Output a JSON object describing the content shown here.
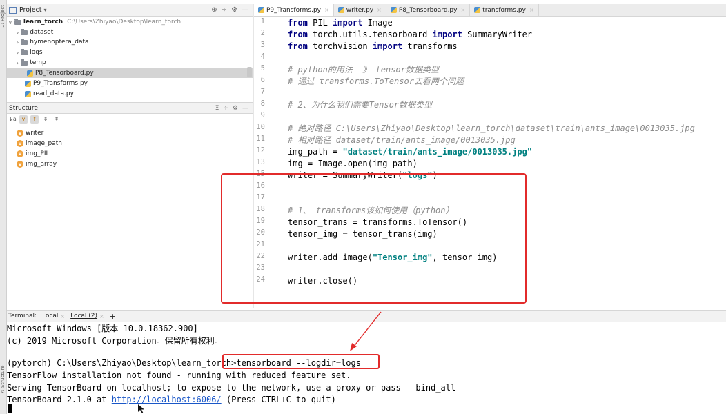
{
  "project_panel": {
    "title": "Project",
    "root": {
      "name": "learn_torch",
      "path": "C:\\Users\\Zhiyao\\Desktop\\learn_torch"
    },
    "items": [
      {
        "label": "dataset",
        "type": "folder"
      },
      {
        "label": "hymenoptera_data",
        "type": "folder"
      },
      {
        "label": "logs",
        "type": "folder"
      },
      {
        "label": "temp",
        "type": "folder"
      },
      {
        "label": "P8_Tensorboard.py",
        "type": "file"
      },
      {
        "label": "P9_Transforms.py",
        "type": "file"
      },
      {
        "label": "read_data.py",
        "type": "file"
      }
    ]
  },
  "left_stripe": {
    "project_tab": "1: Project",
    "structure_tab": "7: Structure"
  },
  "structure_panel": {
    "title": "Structure",
    "toolbar": {
      "sort": "↓a",
      "v_toggle": "v",
      "f_toggle": "f"
    },
    "items": [
      {
        "label": "writer",
        "icon_letter": "v"
      },
      {
        "label": "image_path",
        "icon_letter": "v"
      },
      {
        "label": "img_PIL",
        "icon_letter": "v"
      },
      {
        "label": "img_array",
        "icon_letter": "v"
      }
    ]
  },
  "editor_tabs": [
    {
      "label": "P9_Transforms.py",
      "active": true
    },
    {
      "label": "writer.py",
      "active": false
    },
    {
      "label": "P8_Tensorboard.py",
      "active": false
    },
    {
      "label": "transforms.py",
      "active": false
    }
  ],
  "editor": {
    "lines": [
      {
        "n": "1",
        "code": [
          {
            "t": "kw",
            "v": "from"
          },
          {
            "t": "p",
            "v": " PIL "
          },
          {
            "t": "kw",
            "v": "import"
          },
          {
            "t": "p",
            "v": " Image"
          }
        ]
      },
      {
        "n": "2",
        "code": [
          {
            "t": "kw",
            "v": "from"
          },
          {
            "t": "p",
            "v": " torch.utils.tensorboard "
          },
          {
            "t": "kw",
            "v": "import"
          },
          {
            "t": "p",
            "v": " SummaryWriter"
          }
        ]
      },
      {
        "n": "3",
        "code": [
          {
            "t": "kw",
            "v": "from"
          },
          {
            "t": "p",
            "v": " torchvision "
          },
          {
            "t": "kw",
            "v": "import"
          },
          {
            "t": "p",
            "v": " transforms"
          }
        ]
      },
      {
        "n": "4",
        "code": []
      },
      {
        "n": "5",
        "code": [
          {
            "t": "cm",
            "v": "# python的用法 -》 tensor数据类型"
          }
        ]
      },
      {
        "n": "6",
        "code": [
          {
            "t": "cm",
            "v": "# 通过 transforms.ToTensor去看两个问题"
          }
        ]
      },
      {
        "n": "7",
        "code": []
      },
      {
        "n": "8",
        "code": [
          {
            "t": "cm",
            "v": "# 2、为什么我们需要Tensor数据类型"
          }
        ]
      },
      {
        "n": "9",
        "code": []
      },
      {
        "n": "10",
        "code": [
          {
            "t": "cm",
            "v": "# 绝对路径 C:\\Users\\Zhiyao\\Desktop\\learn_torch\\dataset\\train\\ants_image\\0013035.jpg"
          }
        ]
      },
      {
        "n": "11",
        "code": [
          {
            "t": "cm",
            "v": "# 相对路径 dataset/train/ants_image/0013035.jpg"
          }
        ]
      },
      {
        "n": "12",
        "code": [
          {
            "t": "p",
            "v": "img_path = "
          },
          {
            "t": "str",
            "v": "\"dataset/train/ants_image/0013035.jpg\""
          }
        ]
      },
      {
        "n": "13",
        "code": [
          {
            "t": "p",
            "v": "img = Image.open(img_path)"
          }
        ]
      },
      {
        "n": "15",
        "code": [
          {
            "t": "p",
            "v": "writer = SummaryWriter("
          },
          {
            "t": "str",
            "v": "\"logs\""
          },
          {
            "t": "p",
            "v": ")"
          }
        ]
      },
      {
        "n": "16",
        "code": []
      },
      {
        "n": "17",
        "code": []
      },
      {
        "n": "18",
        "code": [
          {
            "t": "cm",
            "v": "# 1、 transforms该如何使用（python）"
          }
        ]
      },
      {
        "n": "19",
        "code": [
          {
            "t": "p",
            "v": "tensor_trans = transforms.ToTensor()"
          }
        ]
      },
      {
        "n": "20",
        "code": [
          {
            "t": "p",
            "v": "tensor_img = tensor_trans(img)"
          }
        ]
      },
      {
        "n": "21",
        "code": []
      },
      {
        "n": "22",
        "code": [
          {
            "t": "p",
            "v": "writer.add_image("
          },
          {
            "t": "str",
            "v": "\"Tensor_img\""
          },
          {
            "t": "p",
            "v": ", tensor_img)"
          }
        ]
      },
      {
        "n": "23",
        "code": []
      },
      {
        "n": "24",
        "code": [
          {
            "t": "p",
            "v": "writer.close()"
          }
        ]
      }
    ]
  },
  "terminal": {
    "label": "Terminal:",
    "tabs": [
      {
        "label": "Local"
      },
      {
        "label": "Local (2)"
      }
    ],
    "add_label": "+",
    "lines": {
      "l1": "Microsoft Windows [版本 10.0.18362.900]",
      "l2": "(c) 2019 Microsoft Corporation。保留所有权利。",
      "prompt": "(pytorch) C:\\Users\\Zhiyao\\Desktop\\learn_torch>",
      "command": "tensorboard --logdir=logs",
      "l4": "TensorFlow installation not found - running with reduced feature set.",
      "l5": "Serving TensorBoard on localhost; to expose to the network, use a proxy or pass --bind_all",
      "l6_prefix": "TensorBoard 2.1.0 at ",
      "l6_link": "http://localhost:6006/",
      "l6_suffix": " (Press CTRL+C to quit)"
    }
  },
  "colors": {
    "annotation_red": "#e22b2b",
    "keyword": "#000080",
    "string": "#008080",
    "comment": "#8c8c8c",
    "link": "#1a57c8"
  }
}
